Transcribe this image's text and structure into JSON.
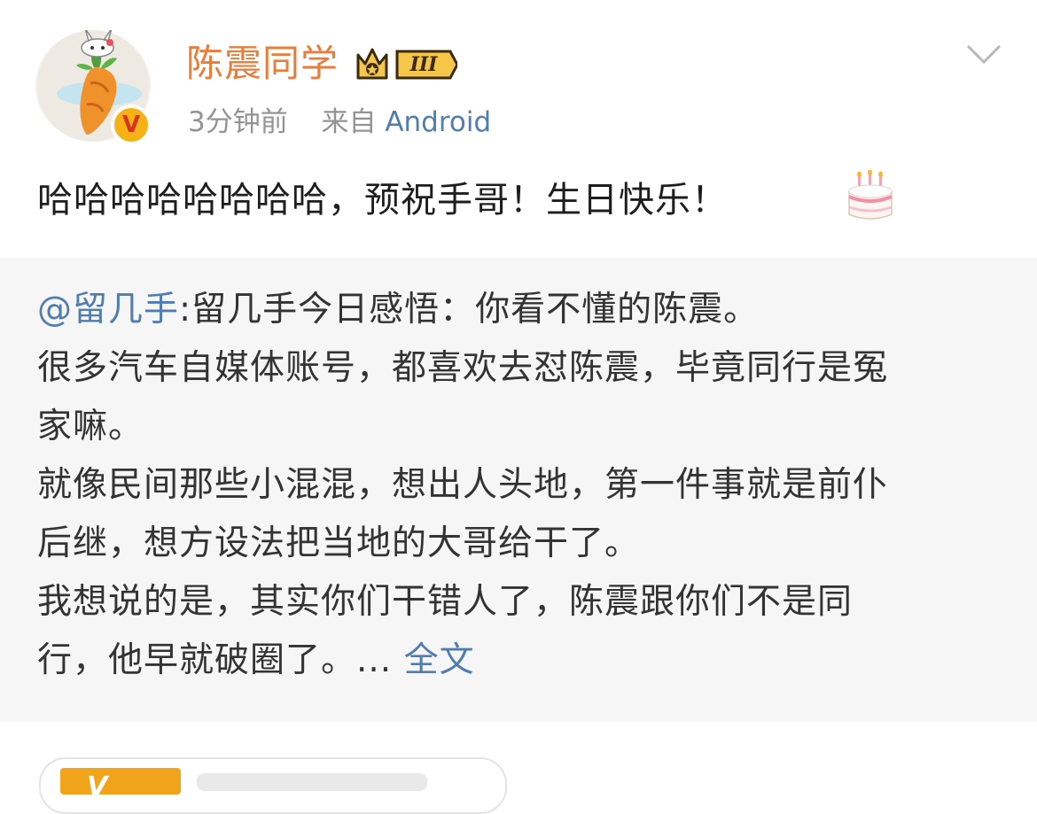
{
  "post": {
    "author": {
      "name": "陈震同学",
      "vip_level": "III",
      "verified_mark": "V",
      "avatar_icon": "carrot-avatar"
    },
    "meta": {
      "time": "3分钟前",
      "source_prefix": "来自",
      "source": "Android"
    },
    "text": "哈哈哈哈哈哈哈哈，预祝手哥！生日快乐！",
    "emoji_icon": "birthday-cake-icon",
    "menu_icon": "chevron-down-icon"
  },
  "repost": {
    "mention": "@留几手",
    "lines": [
      ":留几手今日感悟：你看不懂的陈震。",
      "很多汽车自媒体账号，都喜欢去怼陈震，毕竟同行是冤",
      "家嘛。",
      "就像民间那些小混混，想出人头地，第一件事就是前仆",
      "后继，想方设法把当地的大哥给干了。",
      "我想说的是，其实你们干错人了，陈震跟你们不是同",
      "行，他早就破圈了。..."
    ],
    "more_label": "全文"
  },
  "colors": {
    "username": "#ea7d3a",
    "link": "#507daf",
    "meta": "#939393",
    "repost_bg": "#f6f6f6",
    "vip_gold": "#f6b114"
  },
  "card": {
    "logo_letter": "V"
  }
}
